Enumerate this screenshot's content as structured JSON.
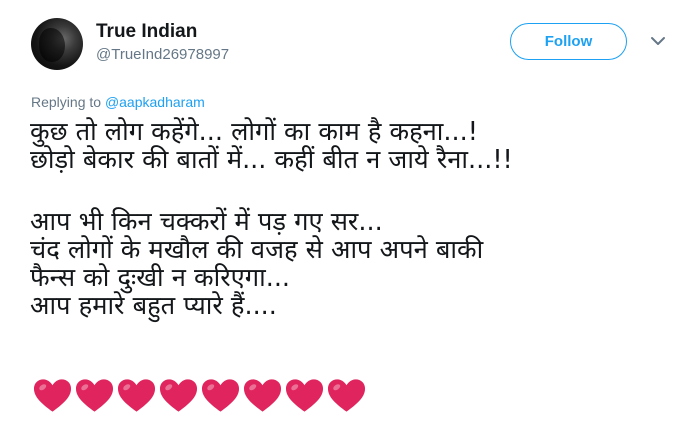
{
  "user": {
    "display_name": "True Indian",
    "handle": "@TrueInd26978997"
  },
  "header": {
    "follow_label": "Follow"
  },
  "reply": {
    "prefix": "Replying to ",
    "mention": "@aapkadharam"
  },
  "tweet": {
    "lines": [
      "कुछ तो लोग कहेंगे... लोगों का काम है कहना...!",
      "छोड़ो बेकार की बातों में... कहीं बीत न जाये रैना...!!",
      "आप भी किन चक्करों में पड़ गए सर...",
      "चंद लोगों के मखौल की वजह से आप अपने बाकी",
      "फैन्स को दुःखी न करिएगा...",
      "आप हमारे बहुत प्यारे हैं...."
    ],
    "heart_count": 8
  },
  "icons": {
    "avatar": "profile-photo",
    "caret": "chevron-down-icon",
    "heart": "red-heart-emoji"
  },
  "colors": {
    "accent": "#1da1f2",
    "text": "#14171a",
    "secondary": "#657786",
    "heart": "#e0245e"
  }
}
